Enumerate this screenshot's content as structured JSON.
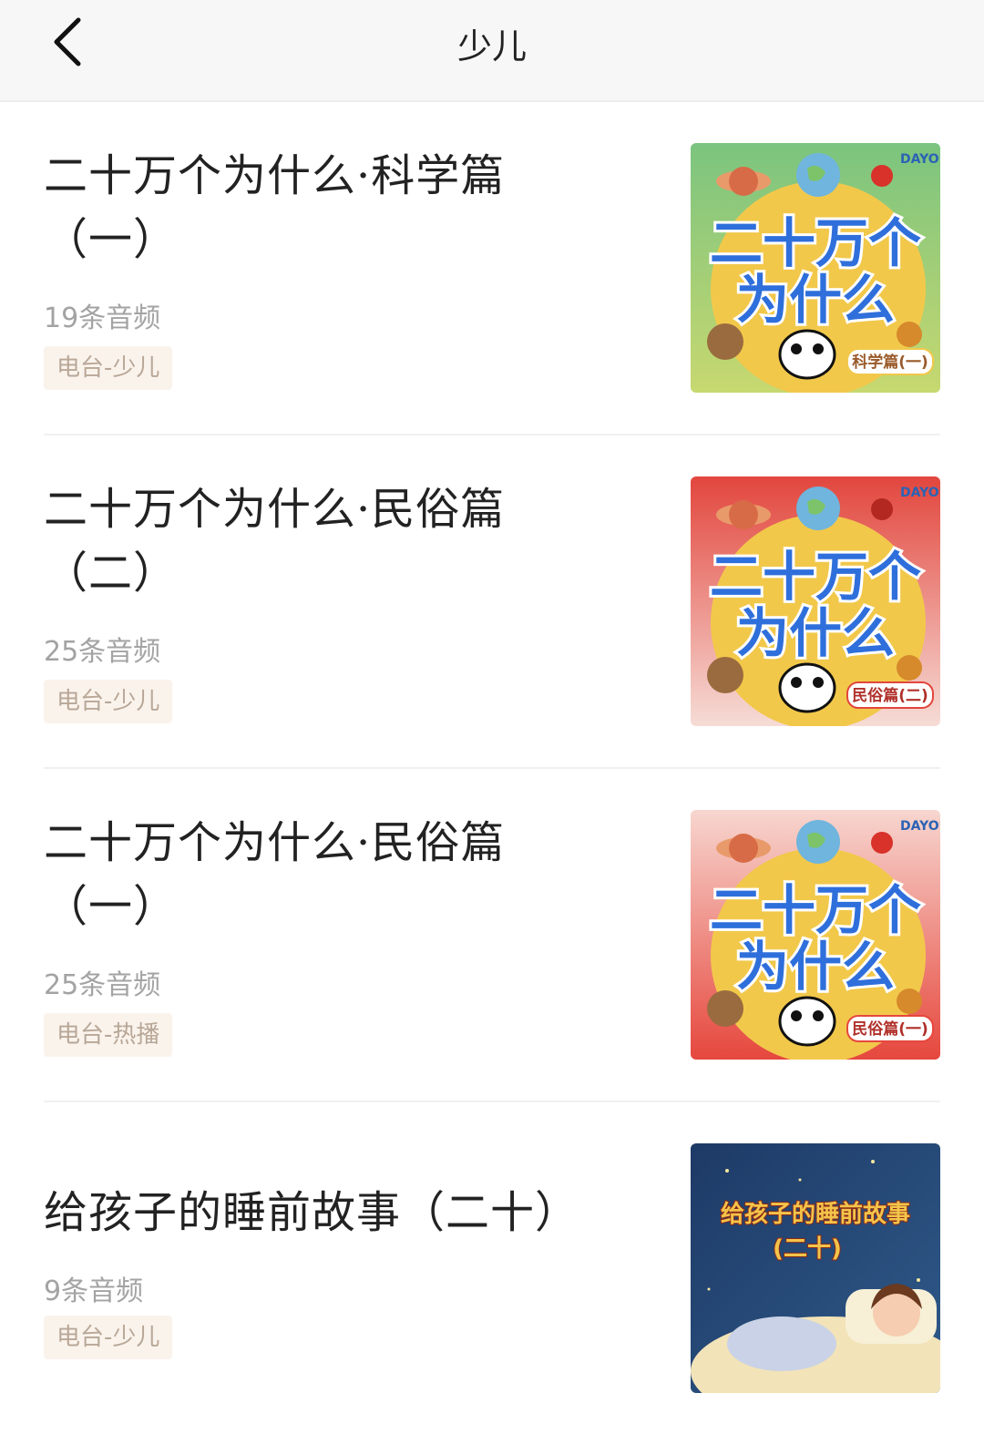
{
  "header": {
    "title": "少儿"
  },
  "items": [
    {
      "title_line1": "二十万个为什么·科学篇",
      "title_line2": "（一）",
      "count": "19条音频",
      "tag": "电台-少儿",
      "cover": {
        "line1": "二十万个",
        "line2": "为什么",
        "badge": "科学篇(一)",
        "brand": "DAYOU",
        "bg_top": "#7bc47f",
        "bg_bottom": "#c7d870"
      }
    },
    {
      "title_line1": "二十万个为什么·民俗篇",
      "title_line2": "（二）",
      "count": "25条音频",
      "tag": "电台-少儿",
      "cover": {
        "line1": "二十万个",
        "line2": "为什么",
        "badge": "民俗篇(二)",
        "brand": "DAYOU",
        "bg_top": "#e2463d",
        "bg_bottom": "#f6dcd6"
      }
    },
    {
      "title_line1": "二十万个为什么·民俗篇",
      "title_line2": "（一）",
      "count": "25条音频",
      "tag": "电台-热播",
      "cover": {
        "line1": "二十万个",
        "line2": "为什么",
        "badge": "民俗篇(一)",
        "brand": "DAYOU",
        "bg_top": "#e6473d",
        "bg_bottom": "#f3b7ae"
      }
    },
    {
      "title_line1": "给孩子的睡前故事（二十）",
      "title_line2": "",
      "count": "9条音频",
      "tag": "电台-少儿",
      "cover": {
        "line1": "给孩子的睡前故事",
        "line2": "(二十)",
        "badge": "",
        "brand": "",
        "bg_top": "#1e3a66",
        "bg_bottom": "#2f5a8a"
      }
    }
  ]
}
